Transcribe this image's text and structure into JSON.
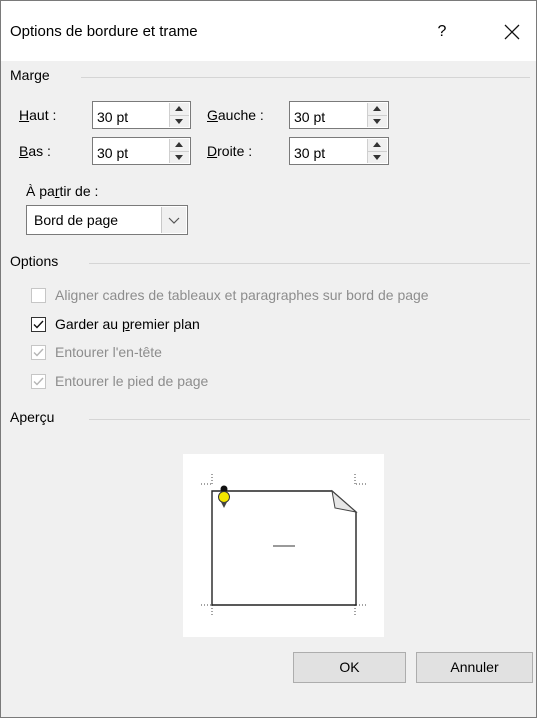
{
  "dialog": {
    "title": "Options de bordure et trame",
    "help": "?",
    "close_icon": "close-icon"
  },
  "margin": {
    "group_label": "Marge",
    "top_label": "Haut :",
    "top_value": "30 pt",
    "left_label": "Gauche :",
    "left_value": "30 pt",
    "bottom_label": "Bas :",
    "bottom_value": "30 pt",
    "right_label": "Droite :",
    "right_value": "30 pt",
    "from_label": "À partir de :",
    "from_value": "Bord de page"
  },
  "options": {
    "group_label": "Options",
    "items": [
      {
        "label": "Aligner cadres de tableaux et paragraphes sur bord de page",
        "checked": false,
        "enabled": false
      },
      {
        "label": "Garder au premier plan",
        "checked": true,
        "enabled": true
      },
      {
        "label": "Entourer l'en-tête",
        "checked": true,
        "enabled": false
      },
      {
        "label": "Entourer le pied de page",
        "checked": true,
        "enabled": false
      }
    ]
  },
  "preview": {
    "group_label": "Aperçu",
    "pin_color": "#f2e600"
  },
  "buttons": {
    "ok": "OK",
    "cancel": "Annuler"
  }
}
